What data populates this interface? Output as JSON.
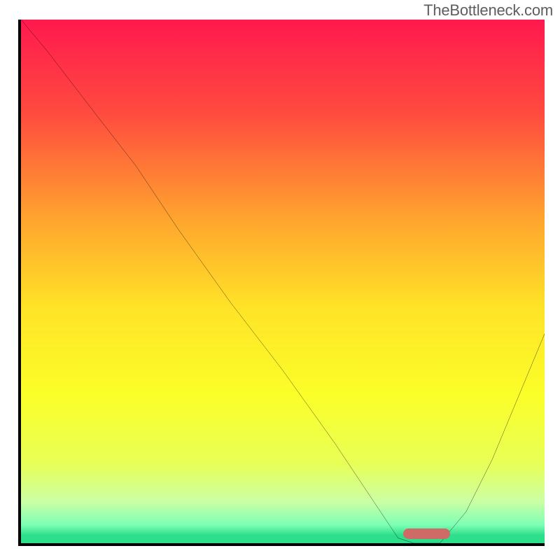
{
  "watermark": "TheBottleneck.com",
  "chart_data": {
    "type": "line",
    "title": "",
    "xlabel": "",
    "ylabel": "",
    "xlim": [
      0,
      100
    ],
    "ylim": [
      0,
      100
    ],
    "grid": false,
    "background_gradient": {
      "direction": "vertical",
      "stops": [
        {
          "offset": 0,
          "color": "#ff194e"
        },
        {
          "offset": 18,
          "color": "#ff4b3f"
        },
        {
          "offset": 38,
          "color": "#ffa42e"
        },
        {
          "offset": 55,
          "color": "#ffe327"
        },
        {
          "offset": 72,
          "color": "#fbff29"
        },
        {
          "offset": 85,
          "color": "#e7ff58"
        },
        {
          "offset": 92,
          "color": "#ccffa4"
        },
        {
          "offset": 96.5,
          "color": "#7dffb4"
        },
        {
          "offset": 98.5,
          "color": "#2dde8a"
        },
        {
          "offset": 100,
          "color": "#2dde8a"
        }
      ]
    },
    "series": [
      {
        "name": "bottleneck-curve",
        "color": "#000000",
        "width": 2.5,
        "x": [
          0,
          5,
          15,
          22,
          30,
          40,
          50,
          60,
          68,
          72,
          75,
          80,
          85,
          90,
          95,
          100
        ],
        "values": [
          100,
          94,
          81,
          72,
          60,
          46,
          33,
          19,
          7,
          1,
          0,
          0,
          6,
          16,
          28,
          40
        ]
      }
    ],
    "annotations": [
      {
        "name": "optimal-marker",
        "shape": "rounded-rect",
        "color": "#ce6b67",
        "x_start": 73,
        "x_end": 82,
        "y": 0.8,
        "height_pct": 2.0
      }
    ]
  }
}
